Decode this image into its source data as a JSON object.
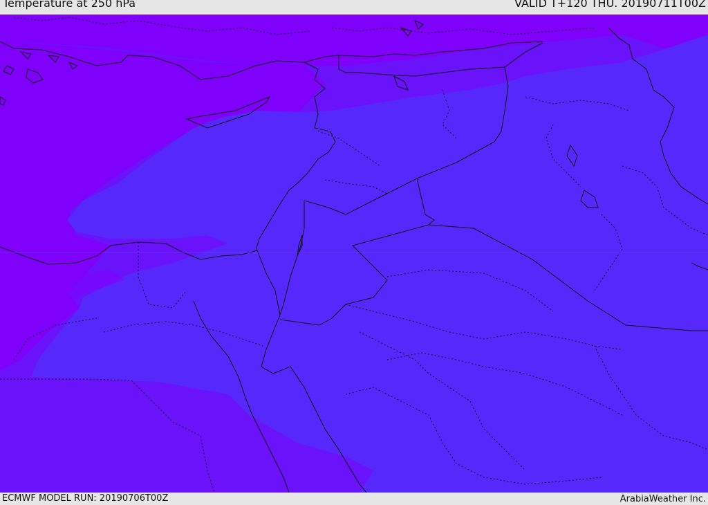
{
  "header": {
    "title": "Temperature at 250 hPa",
    "valid": "VALID T+120 THU. 20190711T00Z"
  },
  "footer": {
    "model_run": "ECMWF MODEL RUN: 20190706T00Z",
    "credit": "ArabiaWeather Inc."
  },
  "map": {
    "colors": {
      "band_cold": "#7f00fb",
      "band_mid": "#6a13fb",
      "band_warm": "#5728fb",
      "coastline": "#111111",
      "border": "#111111"
    }
  }
}
